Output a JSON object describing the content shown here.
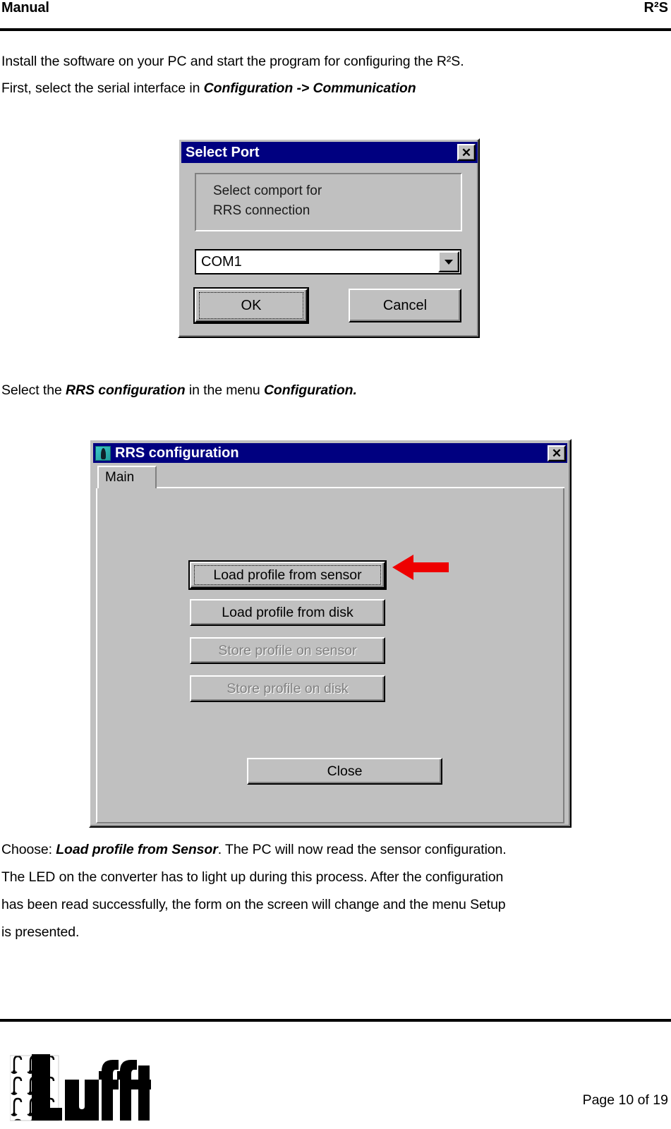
{
  "header": {
    "left_title": "Manual",
    "right_title": "R²S"
  },
  "body": {
    "intro_line1": "Install the software on your PC and start the program for configuring the R²S.",
    "intro_line2_prefix": "First, select the serial interface in ",
    "intro_line2_bold": "Configuration -> Communication",
    "select_rrs_prefix": "Select the ",
    "select_rrs_bold1": "RRS configuration",
    "select_rrs_mid": " in the menu ",
    "select_rrs_bold2": "Configuration.",
    "closing_l1_prefix": "Choose: ",
    "closing_l1_bold": "Load profile from Sensor",
    "closing_l1_suffix": ". The PC will now read the sensor configuration.",
    "closing_l2": "The LED on the converter has to light up during this process. After the configuration",
    "closing_l3": "has been read successfully, the form on the screen will change and the menu Setup",
    "closing_l4": "is presented."
  },
  "select_port_dialog": {
    "title": "Select Port",
    "close_label": "✕",
    "group_line1": "Select comport for",
    "group_line2": "RRS connection",
    "combo_value": "COM1",
    "combo_options": [
      "COM1"
    ],
    "ok_label": "OK",
    "cancel_label": "Cancel"
  },
  "rrs_dialog": {
    "title": "RRS configuration",
    "close_label": "✕",
    "tab_main": "Main",
    "buttons": [
      {
        "label": "Load profile from sensor",
        "enabled": true,
        "focused": true
      },
      {
        "label": "Load profile from disk",
        "enabled": true,
        "focused": false
      },
      {
        "label": "Store profile on sensor",
        "enabled": false,
        "focused": false
      },
      {
        "label": "Store profile on disk",
        "enabled": false,
        "focused": false
      }
    ],
    "close_button_label": "Close",
    "annotation_arrow_color": "#ee0000"
  },
  "footer": {
    "logo_text": "Lufft",
    "page_label": "Page 10 of 19"
  },
  "colors": {
    "titlebar_blue": "#000080",
    "dialog_face": "#c0c0c0",
    "arrow_red": "#ee0000",
    "rule_black": "#000000"
  }
}
